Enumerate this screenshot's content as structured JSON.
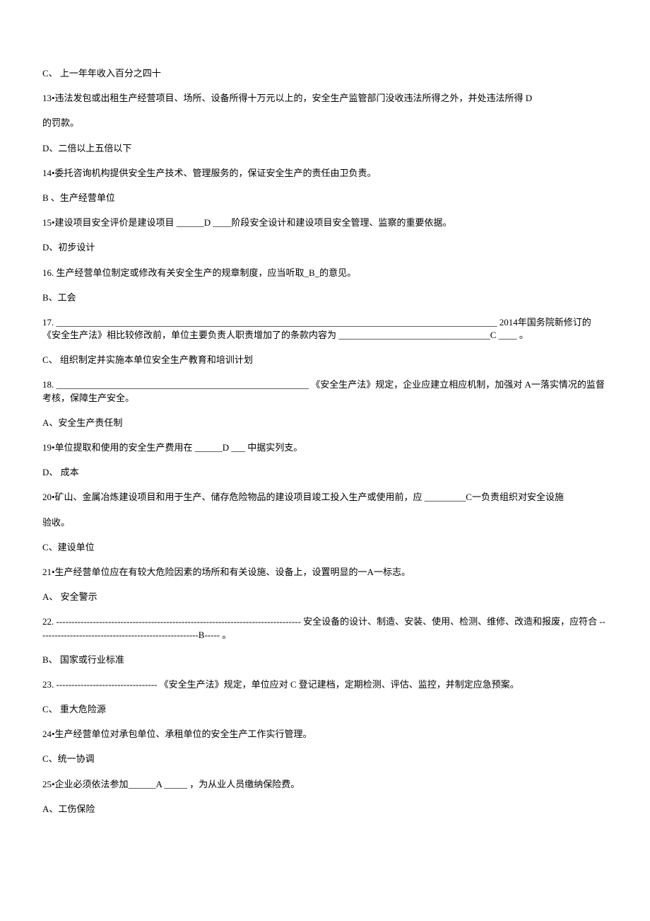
{
  "lines": [
    "C、 上一年年收入百分之四十",
    "13•违法发包或出租生产经营项目、场所、设备所得十万元以上的，安全生产监管部门没收违法所得之外，并处违法所得 D",
    "的罚款。",
    "D、二倍以上五倍以下",
    "14•委托咨询机构提供安全生产技术、管理服务的，保证安全生产的责任由卫负责。",
    " B 、生产经营单位",
    "15•建设项目安全评价是建设项目 ______D ____阶段安全设计和建设项目安全管理、监察的重要依据。",
    " D、初步设计",
    "16. 生产经营单位制定或修改有关安全生产的规章制度，应当听取_B_的意见。",
    " B、工会",
    "17. ________________________________________________________________________________________________ 2014年国务院新修订的《安全生产法》相比较修改前，单位主要负责人职责增加了的条款内容为 _________________________________C ____ 。",
    "C、 组织制定并实施本单位安全生产教育和培训计划",
    "18. _______________________________________________________ 《安全生产法》规定，企业应建立相应机制，加强对    A一落实情况的监督考核，保障生产安全。",
    "A、安全生产责任制",
    "19•单位提取和使用的安全生产费用在 ______D ___ 中据实列支。",
    "D、 成本",
    "20•矿山、金属冶炼建设项目和用于生产、储存危险物品的建设项目竣工投入生产或使用前，应  _________C一负责组织对安全设施",
    "验收。",
    "C、建设单位",
    "21•生产经营单位应在有较大危险因素的场所和有关设施、设备上，设置明显的一A一标志。",
    "A、 安全警示",
    "22. -------------------------------------------------------------------------------- 安全设备的设计、制造、安装、使用、检测、维修、改造和报废，应符合 -----------------------------------------------------B----- 。",
    "B、 国家或行业标准",
    "23. --------------------------------- 《安全生产法》规定，单位应对  C     登记建档，定期检测、评估、监控，并制定应急预案。",
    "C、 重大危险源",
    "24•生产经营单位对承包单位、承租单位的安全生产工作实行管理。",
    " C、统一协调",
    "25•企业必须依法参加______A _____ ，为从业人员缴纳保险费。",
    "A、工伤保险"
  ]
}
